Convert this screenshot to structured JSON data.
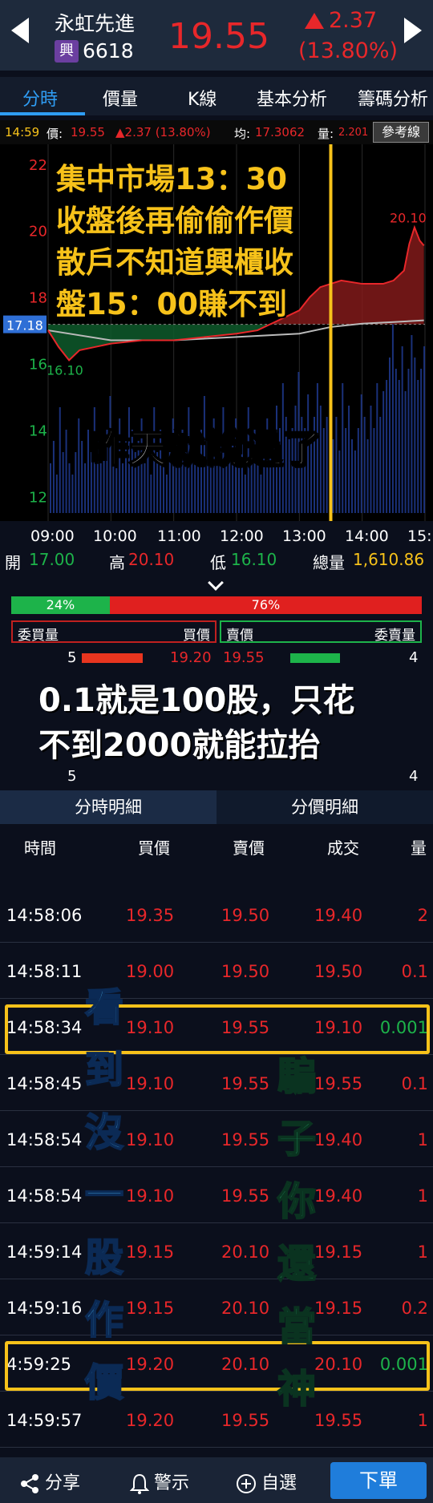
{
  "header": {
    "stock_name": "永虹先進",
    "market_badge": "興",
    "stock_code": "6618",
    "price": "19.55",
    "change": "2.37",
    "change_pct": "(13.80%)"
  },
  "tabs": [
    {
      "label": "分時"
    },
    {
      "label": "價量"
    },
    {
      "label": "K線"
    },
    {
      "label": "基本分析"
    },
    {
      "label": "籌碼分析"
    }
  ],
  "info_bar": {
    "time": "14:59",
    "price_label": "價:",
    "price": "19.55",
    "change": "▲2.37 (13.80%)",
    "avg_label": "均:",
    "avg": "17.3062",
    "vol_label": "量:",
    "vol": "2.201",
    "ref_button": "參考線"
  },
  "chart_data": {
    "type": "line",
    "y_ticks": [
      "22",
      "20",
      "18",
      "16",
      "14",
      "12"
    ],
    "x_ticks": [
      "09:00",
      "10:00",
      "11:00",
      "12:00",
      "13:00",
      "14:00",
      "15:"
    ],
    "ref_price": "17.18",
    "low_label": "16.10",
    "high_label": "20.10",
    "ylim": [
      11.5,
      22.6
    ],
    "price_series": {
      "x": [
        "09:00",
        "09:10",
        "09:20",
        "09:30",
        "09:45",
        "10:00",
        "10:30",
        "11:00",
        "11:30",
        "12:00",
        "12:20",
        "12:40",
        "13:00",
        "13:10",
        "13:20",
        "13:30",
        "13:40",
        "14:00",
        "14:20",
        "14:30",
        "14:40",
        "14:45",
        "14:50",
        "14:55",
        "14:59"
      ],
      "y": [
        17.0,
        16.5,
        16.1,
        16.4,
        16.5,
        16.6,
        16.7,
        16.7,
        16.8,
        16.9,
        17.0,
        17.3,
        17.6,
        18.0,
        18.3,
        18.4,
        18.5,
        18.4,
        18.4,
        18.5,
        18.8,
        19.6,
        20.1,
        19.7,
        19.55
      ]
    },
    "avg_series": {
      "x": [
        "09:00",
        "10:00",
        "11:00",
        "12:00",
        "13:00",
        "13:30",
        "14:00",
        "14:30",
        "14:59"
      ],
      "y": [
        17.0,
        16.7,
        16.7,
        16.8,
        16.9,
        17.1,
        17.2,
        17.25,
        17.3
      ]
    }
  },
  "ohlc": {
    "open_label": "開",
    "open": "17.00",
    "high_label": "高",
    "high": "20.10",
    "low_label": "低",
    "low": "16.10",
    "total_label": "總量",
    "total": "1,610.86"
  },
  "ratio": {
    "buy_pct": "24%",
    "sell_pct": "76%",
    "buy_fraction": 0.24
  },
  "orderbook": {
    "bid_qty_label": "委買量",
    "bid_price_label": "買價",
    "ask_price_label": "賣價",
    "ask_qty_label": "委賣量",
    "row1": {
      "bid_qty": "5",
      "bid_price": "19.20",
      "ask_price": "19.55",
      "ask_qty": "4"
    },
    "row_last": {
      "bid_qty": "5",
      "ask_qty": "4"
    }
  },
  "overlays": {
    "yellow_text_1": "集中市場13：30",
    "yellow_text_2": "收盤後再偷偷作價",
    "yellow_text_3": "散戶不知道興櫃收",
    "yellow_text_4": "盤15：00賺不到",
    "big_white": "昨天就說過了",
    "white_2a": "0.1就是100股，只花",
    "white_2b": "不到2000就能拉抬",
    "blue_vertical": [
      "看",
      "到",
      "沒",
      "一",
      "股",
      "作",
      "價"
    ],
    "green_vertical": [
      "騙",
      "子",
      "你",
      "還",
      "當",
      "神"
    ]
  },
  "sub_tabs": {
    "active": "分時明細",
    "inactive": "分價明細"
  },
  "ticks_header": {
    "time": "時間",
    "bid": "買價",
    "ask": "賣價",
    "last": "成交",
    "vol": "量"
  },
  "ticks": [
    {
      "time": "14:58:06",
      "bid": "19.35",
      "ask": "19.50",
      "last": "19.40",
      "vol": "2"
    },
    {
      "time": "14:58:11",
      "bid": "19.00",
      "ask": "19.50",
      "last": "19.50",
      "vol": "0.1"
    },
    {
      "time": "14:58:34",
      "bid": "19.10",
      "ask": "19.55",
      "last": "19.10",
      "vol": "0.001"
    },
    {
      "time": "14:58:45",
      "bid": "19.10",
      "ask": "19.55",
      "last": "19.55",
      "vol": "0.1"
    },
    {
      "time": "14:58:54",
      "bid": "19.10",
      "ask": "19.55",
      "last": "19.40",
      "vol": "1"
    },
    {
      "time": "14:58:54",
      "bid": "19.10",
      "ask": "19.55",
      "last": "19.40",
      "vol": "1"
    },
    {
      "time": "14:59:14",
      "bid": "19.15",
      "ask": "20.10",
      "last": "19.15",
      "vol": "1"
    },
    {
      "time": "14:59:16",
      "bid": "19.15",
      "ask": "20.10",
      "last": "19.15",
      "vol": "0.2"
    },
    {
      "time": "4:59:25",
      "bid": "19.20",
      "ask": "20.10",
      "last": "20.10",
      "vol": "0.001"
    },
    {
      "time": "14:59:57",
      "bid": "19.20",
      "ask": "19.55",
      "last": "19.55",
      "vol": "1"
    }
  ],
  "bottom_bar": {
    "share": "分享",
    "alert": "警示",
    "watch": "自選",
    "order": "下單"
  },
  "colors": {
    "up": "#e8272a",
    "down": "#1db34a",
    "accent": "#2f9df4",
    "highlight": "#f7c21a"
  }
}
